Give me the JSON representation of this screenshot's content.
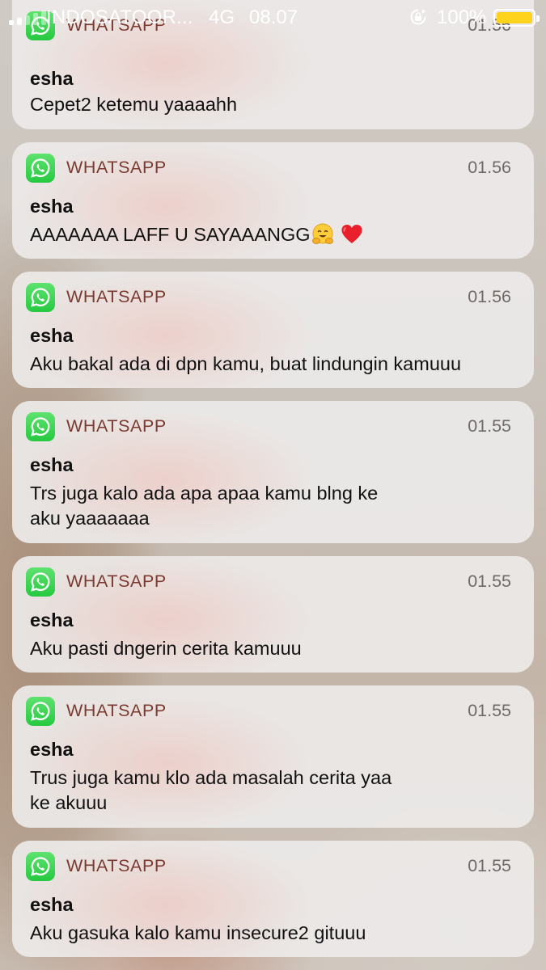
{
  "status_bar": {
    "carrier": "INDOSATOOR...",
    "network": "4G",
    "time": "08.07",
    "battery": "100%"
  },
  "notifications": [
    {
      "app": "WHATSAPP",
      "time": "01.56",
      "sender": "esha",
      "message": "Cepet2 ketemu yaaaahh"
    },
    {
      "app": "WHATSAPP",
      "time": "01.56",
      "sender": "esha",
      "message": "AAAAAAA LAFF U SAYAAANGG"
    },
    {
      "app": "WHATSAPP",
      "time": "01.56",
      "sender": "esha",
      "message": "Aku bakal ada di dpn kamu, buat lindungin kamuuu"
    },
    {
      "app": "WHATSAPP",
      "time": "01.55",
      "sender": "esha",
      "message": "Trs juga kalo ada apa apaa kamu blng ke\naku yaaaaaaa"
    },
    {
      "app": "WHATSAPP",
      "time": "01.55",
      "sender": "esha",
      "message": "Aku pasti dngerin cerita kamuuu"
    },
    {
      "app": "WHATSAPP",
      "time": "01.55",
      "sender": "esha",
      "message": "Trus juga kamu klo ada masalah cerita yaa\nke akuuu"
    },
    {
      "app": "WHATSAPP",
      "time": "01.55",
      "sender": "esha",
      "message": "Aku gasuka kalo kamu insecure2 gituuu"
    }
  ],
  "icons": {
    "app_icon": "whatsapp-icon",
    "emojis": [
      "hugging-face-emoji",
      "red-heart-emoji"
    ],
    "status": [
      "signal-bars-icon",
      "rotation-lock-icon",
      "battery-icon"
    ]
  },
  "colors": {
    "whatsapp_green": "#25D366",
    "app_name": "#7b3a2f",
    "battery_fill": "#ffd21c"
  }
}
